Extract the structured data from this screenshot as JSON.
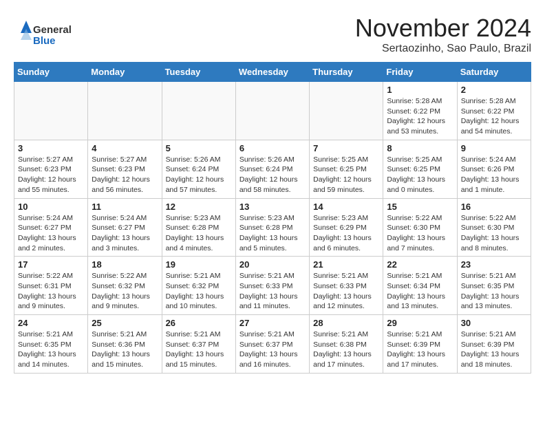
{
  "header": {
    "logo": {
      "general": "General",
      "blue": "Blue"
    },
    "title": "November 2024",
    "location": "Sertaozinho, Sao Paulo, Brazil"
  },
  "weekdays": [
    "Sunday",
    "Monday",
    "Tuesday",
    "Wednesday",
    "Thursday",
    "Friday",
    "Saturday"
  ],
  "weeks": [
    [
      {
        "day": "",
        "info": ""
      },
      {
        "day": "",
        "info": ""
      },
      {
        "day": "",
        "info": ""
      },
      {
        "day": "",
        "info": ""
      },
      {
        "day": "",
        "info": ""
      },
      {
        "day": "1",
        "info": "Sunrise: 5:28 AM\nSunset: 6:22 PM\nDaylight: 12 hours\nand 53 minutes."
      },
      {
        "day": "2",
        "info": "Sunrise: 5:28 AM\nSunset: 6:22 PM\nDaylight: 12 hours\nand 54 minutes."
      }
    ],
    [
      {
        "day": "3",
        "info": "Sunrise: 5:27 AM\nSunset: 6:23 PM\nDaylight: 12 hours\nand 55 minutes."
      },
      {
        "day": "4",
        "info": "Sunrise: 5:27 AM\nSunset: 6:23 PM\nDaylight: 12 hours\nand 56 minutes."
      },
      {
        "day": "5",
        "info": "Sunrise: 5:26 AM\nSunset: 6:24 PM\nDaylight: 12 hours\nand 57 minutes."
      },
      {
        "day": "6",
        "info": "Sunrise: 5:26 AM\nSunset: 6:24 PM\nDaylight: 12 hours\nand 58 minutes."
      },
      {
        "day": "7",
        "info": "Sunrise: 5:25 AM\nSunset: 6:25 PM\nDaylight: 12 hours\nand 59 minutes."
      },
      {
        "day": "8",
        "info": "Sunrise: 5:25 AM\nSunset: 6:25 PM\nDaylight: 13 hours\nand 0 minutes."
      },
      {
        "day": "9",
        "info": "Sunrise: 5:24 AM\nSunset: 6:26 PM\nDaylight: 13 hours\nand 1 minute."
      }
    ],
    [
      {
        "day": "10",
        "info": "Sunrise: 5:24 AM\nSunset: 6:27 PM\nDaylight: 13 hours\nand 2 minutes."
      },
      {
        "day": "11",
        "info": "Sunrise: 5:24 AM\nSunset: 6:27 PM\nDaylight: 13 hours\nand 3 minutes."
      },
      {
        "day": "12",
        "info": "Sunrise: 5:23 AM\nSunset: 6:28 PM\nDaylight: 13 hours\nand 4 minutes."
      },
      {
        "day": "13",
        "info": "Sunrise: 5:23 AM\nSunset: 6:28 PM\nDaylight: 13 hours\nand 5 minutes."
      },
      {
        "day": "14",
        "info": "Sunrise: 5:23 AM\nSunset: 6:29 PM\nDaylight: 13 hours\nand 6 minutes."
      },
      {
        "day": "15",
        "info": "Sunrise: 5:22 AM\nSunset: 6:30 PM\nDaylight: 13 hours\nand 7 minutes."
      },
      {
        "day": "16",
        "info": "Sunrise: 5:22 AM\nSunset: 6:30 PM\nDaylight: 13 hours\nand 8 minutes."
      }
    ],
    [
      {
        "day": "17",
        "info": "Sunrise: 5:22 AM\nSunset: 6:31 PM\nDaylight: 13 hours\nand 9 minutes."
      },
      {
        "day": "18",
        "info": "Sunrise: 5:22 AM\nSunset: 6:32 PM\nDaylight: 13 hours\nand 9 minutes."
      },
      {
        "day": "19",
        "info": "Sunrise: 5:21 AM\nSunset: 6:32 PM\nDaylight: 13 hours\nand 10 minutes."
      },
      {
        "day": "20",
        "info": "Sunrise: 5:21 AM\nSunset: 6:33 PM\nDaylight: 13 hours\nand 11 minutes."
      },
      {
        "day": "21",
        "info": "Sunrise: 5:21 AM\nSunset: 6:33 PM\nDaylight: 13 hours\nand 12 minutes."
      },
      {
        "day": "22",
        "info": "Sunrise: 5:21 AM\nSunset: 6:34 PM\nDaylight: 13 hours\nand 13 minutes."
      },
      {
        "day": "23",
        "info": "Sunrise: 5:21 AM\nSunset: 6:35 PM\nDaylight: 13 hours\nand 13 minutes."
      }
    ],
    [
      {
        "day": "24",
        "info": "Sunrise: 5:21 AM\nSunset: 6:35 PM\nDaylight: 13 hours\nand 14 minutes."
      },
      {
        "day": "25",
        "info": "Sunrise: 5:21 AM\nSunset: 6:36 PM\nDaylight: 13 hours\nand 15 minutes."
      },
      {
        "day": "26",
        "info": "Sunrise: 5:21 AM\nSunset: 6:37 PM\nDaylight: 13 hours\nand 15 minutes."
      },
      {
        "day": "27",
        "info": "Sunrise: 5:21 AM\nSunset: 6:37 PM\nDaylight: 13 hours\nand 16 minutes."
      },
      {
        "day": "28",
        "info": "Sunrise: 5:21 AM\nSunset: 6:38 PM\nDaylight: 13 hours\nand 17 minutes."
      },
      {
        "day": "29",
        "info": "Sunrise: 5:21 AM\nSunset: 6:39 PM\nDaylight: 13 hours\nand 17 minutes."
      },
      {
        "day": "30",
        "info": "Sunrise: 5:21 AM\nSunset: 6:39 PM\nDaylight: 13 hours\nand 18 minutes."
      }
    ]
  ]
}
